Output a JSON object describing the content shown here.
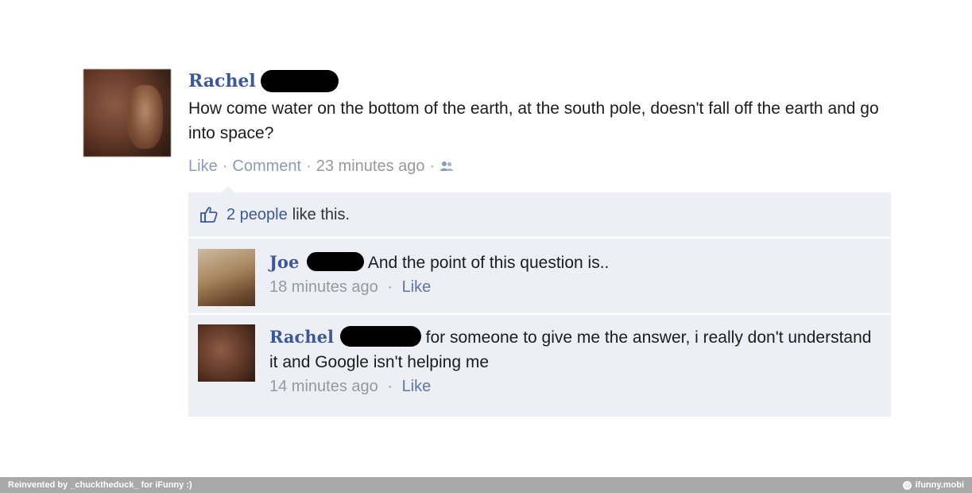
{
  "post": {
    "author": "Rachel",
    "text": "How come water on the bottom of the earth, at the south pole, doesn't fall off the earth and go into space?",
    "actions": {
      "like": "Like",
      "comment": "Comment",
      "time": "23 minutes ago",
      "separator": "·"
    }
  },
  "likes": {
    "count_link": "2 people",
    "rest": "like this."
  },
  "comments": [
    {
      "author": "Joe",
      "text": "And the point of this question is..",
      "time": "18 minutes ago",
      "like": "Like"
    },
    {
      "author": "Rachel",
      "text": "for someone to give me the answer, i really don't understand it and Google isn't helping me",
      "time": "14 minutes ago",
      "like": "Like"
    }
  ],
  "footer": {
    "credit": "Reinvented by _chucktheduck_ for iFunny :)",
    "brand": "ifunny.mobi"
  },
  "colors": {
    "link": "#3b5998",
    "panel": "#edeff4",
    "footer_bg": "#a9a9a9",
    "redaction": "#000000"
  }
}
